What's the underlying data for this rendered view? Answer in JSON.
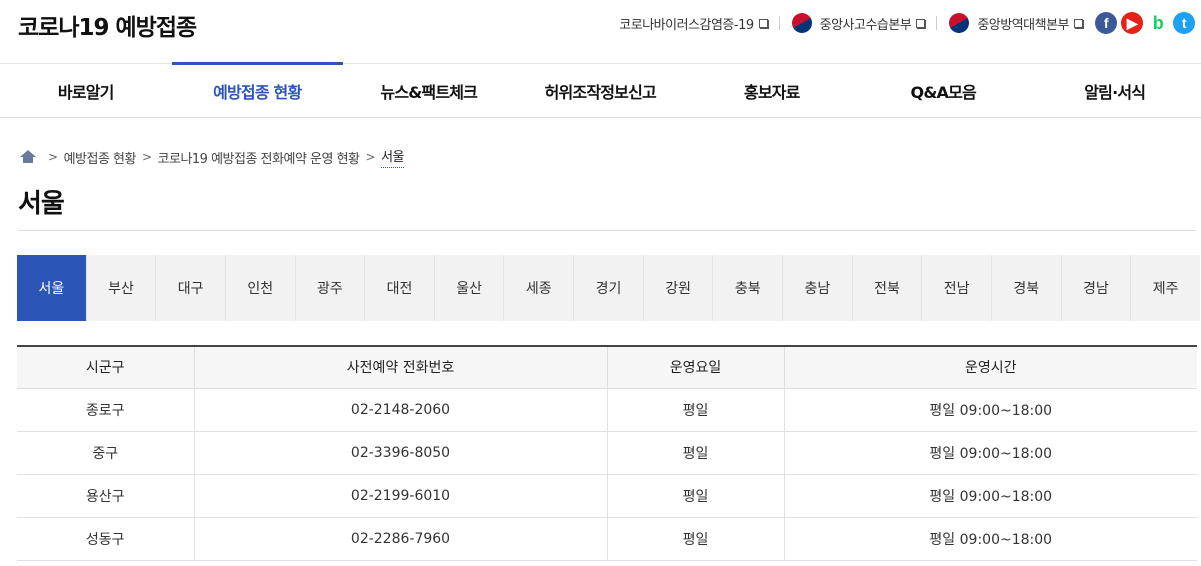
{
  "site": {
    "logo": "코로나19 예방접종"
  },
  "util_links": [
    {
      "label": "코로나바이러스감염증-19"
    },
    {
      "label": "중앙사고수습본부"
    },
    {
      "label": "중앙방역대책본부"
    }
  ],
  "sns": {
    "facebook": "f",
    "youtube": "▶",
    "blog": "b",
    "twitter": "t"
  },
  "gnb": [
    "바로알기",
    "예방접종 현황",
    "뉴스&팩트체크",
    "허위조작정보신고",
    "홍보자료",
    "Q&A모음",
    "알림·서식"
  ],
  "breadcrumb": {
    "items": [
      "예방접종 현황",
      "코로나19 예방접종 전화예약 운영 현황"
    ],
    "current": "서울",
    "separator": ">"
  },
  "page_title": "서울",
  "regions": [
    "서울",
    "부산",
    "대구",
    "인천",
    "광주",
    "대전",
    "울산",
    "세종",
    "경기",
    "강원",
    "충북",
    "충남",
    "전북",
    "전남",
    "경북",
    "경남",
    "제주"
  ],
  "table": {
    "headers": [
      "시군구",
      "사전예약 전화번호",
      "운영요일",
      "운영시간"
    ],
    "rows": [
      [
        "종로구",
        "02-2148-2060",
        "평일",
        "평일 09:00~18:00"
      ],
      [
        "중구",
        "02-3396-8050",
        "평일",
        "평일 09:00~18:00"
      ],
      [
        "용산구",
        "02-2199-6010",
        "평일",
        "평일 09:00~18:00"
      ],
      [
        "성동구",
        "02-2286-7960",
        "평일",
        "평일 09:00~18:00"
      ]
    ]
  },
  "colors": {
    "accent": "#2b56b8",
    "tab_bg": "#f2f2f2"
  }
}
